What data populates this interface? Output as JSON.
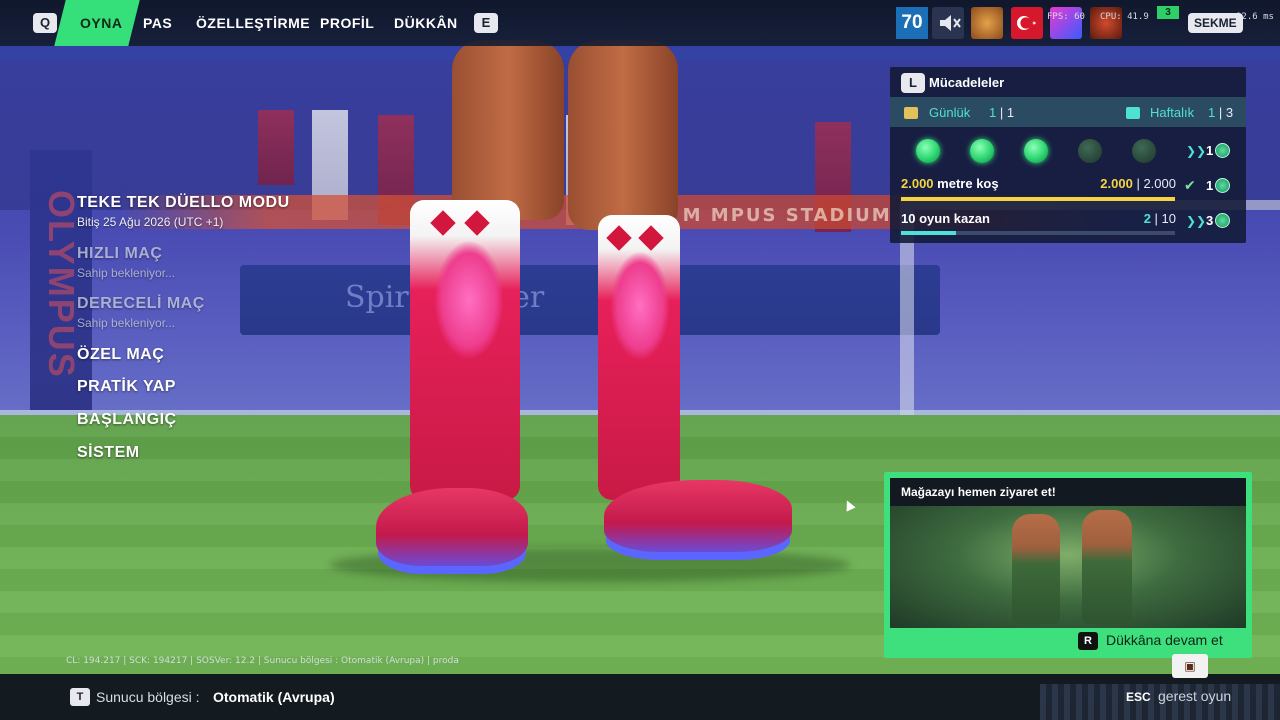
{
  "topbar": {
    "left_key": "Q",
    "right_key": "E",
    "tabs": [
      {
        "label": "OYNA",
        "active": true
      },
      {
        "label": "PAS",
        "active": false
      },
      {
        "label": "ÖZELLEŞTİRME",
        "active": false
      },
      {
        "label": "PROFİL",
        "active": false
      },
      {
        "label": "DÜKKÂN",
        "active": false
      }
    ],
    "level": "70",
    "icons": [
      "mute-icon",
      "lion-avatar-icon",
      "turkey-flag-icon",
      "gem-rank-icon",
      "rank-emblem-icon"
    ],
    "stats": {
      "fps": "FPS: 60",
      "cpu": "CPU: 41.9",
      "chip": "3",
      "ms": "12.6 ms"
    },
    "menu_key": "SEKME"
  },
  "menu": {
    "items": [
      {
        "title": "TEKE TEK DÜELLO MODU",
        "subtitle": "Bitiş 25 Ağu 2026 (UTC +1)",
        "dim": false
      },
      {
        "title": "HIZLI MAÇ",
        "subtitle": "Sahip bekleniyor...",
        "dim": true
      },
      {
        "title": "DERECELİ MAÇ",
        "subtitle": "Sahip bekleniyor...",
        "dim": true
      },
      {
        "title": "ÖZEL MAÇ",
        "subtitle": "",
        "dim": false
      },
      {
        "title": "PRATİK YAP",
        "subtitle": "",
        "dim": false
      },
      {
        "title": "BAŞLANGIÇ",
        "subtitle": "",
        "dim": false
      },
      {
        "title": "SİSTEM",
        "subtitle": "",
        "dim": false
      }
    ]
  },
  "challenges": {
    "key": "L",
    "title": "Mücadeleler",
    "daily": {
      "label": "Günlük",
      "done": "1",
      "total": "1"
    },
    "weekly": {
      "label": "Haftalık",
      "done": "1",
      "total": "3"
    },
    "dots_filled": 3,
    "dots_total": 5,
    "dots_reward": "1",
    "tasks": [
      {
        "label_value": "2.000",
        "label_text": "metre koş",
        "progress": "2.000",
        "total": "2.000",
        "fraction": 1.0,
        "reward": "1",
        "done": true,
        "color": "#f4d442"
      },
      {
        "label_value": "10",
        "label_text": "oyun kazan",
        "progress": "2",
        "total": "10",
        "fraction": 0.2,
        "reward": "3",
        "done": false,
        "color": "#4fe1d1"
      }
    ]
  },
  "store": {
    "title": "Mağazayı hemen ziyaret et!",
    "key": "R",
    "cta": "Dükkâna devam et"
  },
  "footer": {
    "debug": "CL: 194.217 | SCK: 194217 | SOSVer: 12.2 | Sunucu bölgesi : Otomatik (Avrupa) | proda",
    "region_key": "T",
    "region_label": "Sunucu bölgesi :",
    "region_value": "Otomatik (Avrupa)",
    "esc_key": "ESC",
    "esc_text": "gerest oyun"
  },
  "scene": {
    "banner": "HO      M    MPUS STADIUM",
    "wall": "Spirit Soccer",
    "pillar": "OLYMPUS"
  },
  "colors": {
    "accent_green": "#35e07b",
    "teal": "#4fe1d1",
    "yellow": "#f4d442"
  }
}
